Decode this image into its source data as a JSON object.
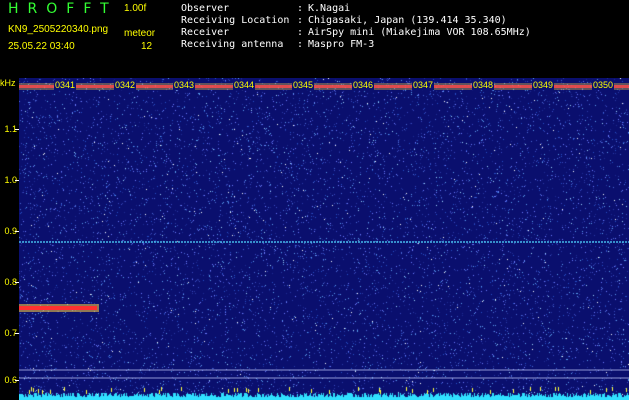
{
  "header": {
    "title": "HROFFT",
    "version": "1.00f",
    "filename": "KN9_2505220340.png",
    "timestamp": "25.05.22 03:40",
    "mode_label": "meteor",
    "count": "12"
  },
  "metadata": [
    {
      "label": "Observer",
      "value": "K.Nagai"
    },
    {
      "label": "Receiving Location",
      "value": "Chigasaki, Japan (139.414 35.340)"
    },
    {
      "label": "Receiver",
      "value": "AirSpy mini (Miakejima VOR 108.65MHz)"
    },
    {
      "label": "Receiving antenna",
      "value": "Maspro FM-3"
    }
  ],
  "axis": {
    "unit_label": "kHz",
    "ticks": [
      {
        "label": "1.1",
        "value": 1.1
      },
      {
        "label": "1.0",
        "value": 1.0
      },
      {
        "label": "0.9",
        "value": 0.9
      },
      {
        "label": "0.8",
        "value": 0.8
      },
      {
        "label": "0.7",
        "value": 0.7
      },
      {
        "label": "0.6",
        "value": 0.6
      }
    ],
    "time_labels": [
      "0341",
      "0342",
      "0343",
      "0344",
      "0345",
      "0346",
      "0347",
      "0348",
      "0349",
      "0350"
    ]
  },
  "colors": {
    "background": "#000000",
    "spectrogram_bg": "#0a0f6e",
    "title_green": "#33ff33",
    "label_yellow": "#ffff00",
    "meta_white": "#ffffff",
    "carrier_line": "#4fd6ff",
    "signal_band": "#ff3030",
    "noise_floor": "#30e0ff"
  }
}
